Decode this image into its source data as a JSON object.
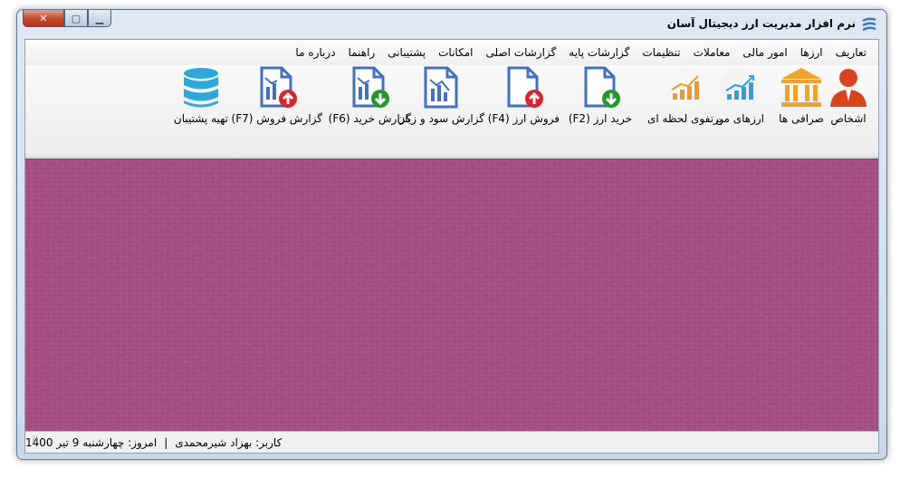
{
  "window": {
    "title": "نرم افزار مدیریت ارز دیجیتال آسان",
    "controls": {
      "close": "✕",
      "maximize": "▢",
      "minimize": "▁"
    }
  },
  "menu": [
    "تعاریف",
    "ارزها",
    "امور مالی",
    "معاملات",
    "تنظیمات",
    "گزارشات پایه",
    "گزارشات اصلی",
    "امکانات",
    "پشتیبانی",
    "راهنما",
    "درباره ما"
  ],
  "toolbar": {
    "persons": {
      "label": "اشخاص",
      "icon": "person-icon"
    },
    "exchanges": {
      "label": "صرافی ها",
      "icon": "bank-icon"
    },
    "my_currencies": {
      "label": "ارزهای من",
      "icon": "chart-up-icon"
    },
    "portfolio": {
      "label": "پرتفوی لحظه ای",
      "icon": "chart-bars-icon"
    },
    "buy": {
      "label": "خرید ارز (F2)",
      "icon": "doc-download-icon"
    },
    "sell": {
      "label": "فروش ارز (F4)",
      "icon": "doc-upload-icon"
    },
    "profit_loss": {
      "label": "گزارش سود و زیان",
      "icon": "report-icon"
    },
    "buy_report": {
      "label": "گزارش خرید (F6)",
      "icon": "report-download-icon"
    },
    "sell_report": {
      "label": "گزارش فروش (F7)",
      "icon": "report-upload-icon"
    },
    "backup": {
      "label": "تهیه پشتیبان",
      "icon": "database-icon"
    }
  },
  "status": {
    "today": "امروز: چهارشنبه 9 تیر 1400",
    "separator": "|",
    "user": "کاربر: بهزاد شیرمحمدی"
  },
  "colors": {
    "workspace": "#a84e83",
    "person": "#d9441b",
    "bank": "#f3a12a",
    "chart_blue": "#27a3e0",
    "chart_orange": "#f39a1e",
    "doc_blue": "#3f6fc9",
    "arrow_green": "#1f9b2e",
    "arrow_red": "#e0202a",
    "database": "#2da8df"
  }
}
